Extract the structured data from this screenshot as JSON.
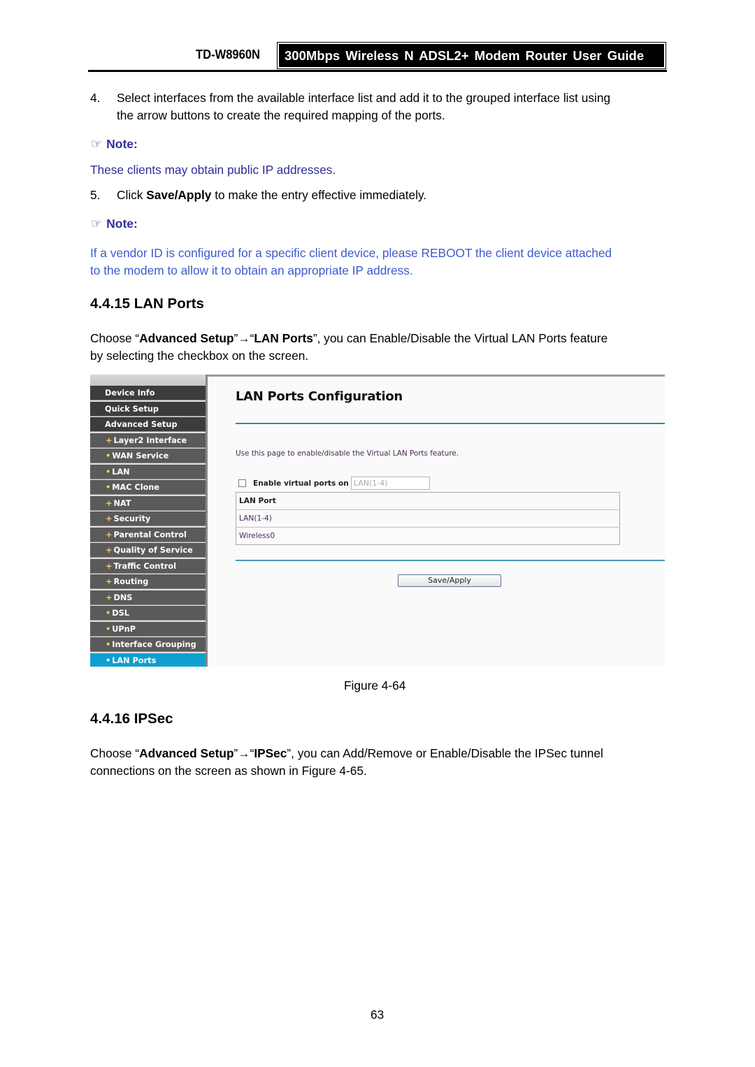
{
  "header": {
    "model": "TD-W8960N",
    "guide_title": "300Mbps Wireless N ADSL2+ Modem Router User Guide"
  },
  "steps": {
    "step4_number": "4.",
    "step4_line1": "Select interfaces from the available interface list and add it to the grouped interface list using",
    "step4_line2": "the arrow buttons to create the required mapping of the ports.",
    "step5_number": "5.",
    "step5_pre": "Click ",
    "step5_bold": "Save/Apply",
    "step5_post": " to make the entry effective immediately."
  },
  "notes": [
    {
      "icon": "pointing-hand-icon",
      "label": "Note:",
      "text": "These clients may obtain public IP addresses."
    },
    {
      "icon": "pointing-hand-icon",
      "label": "Note:",
      "line1": "If a vendor ID is configured for a specific client device, please REBOOT the client device attached",
      "line2": "to the modem to allow it to obtain an appropriate IP address."
    }
  ],
  "section_lan": {
    "heading": "4.4.15 LAN Ports",
    "p_pre": "Choose “",
    "p_bold1": "Advanced Setup",
    "p_mid": "”→“",
    "p_bold2": "LAN Ports",
    "p_post": "”, you can Enable/Disable the Virtual LAN Ports feature",
    "p_line2": "by selecting the checkbox on the screen."
  },
  "figure": {
    "sidebar": [
      {
        "label": "Device Info",
        "type": "top",
        "bullet": ""
      },
      {
        "label": "Quick Setup",
        "type": "top",
        "bullet": ""
      },
      {
        "label": "Advanced Setup",
        "type": "top",
        "bullet": ""
      },
      {
        "label": "Layer2 Interface",
        "type": "sub",
        "bullet": "+"
      },
      {
        "label": "WAN Service",
        "type": "sub",
        "bullet": "•"
      },
      {
        "label": "LAN",
        "type": "sub",
        "bullet": "•"
      },
      {
        "label": "MAC Clone",
        "type": "sub",
        "bullet": "•"
      },
      {
        "label": "NAT",
        "type": "sub",
        "bullet": "+"
      },
      {
        "label": "Security",
        "type": "sub",
        "bullet": "+"
      },
      {
        "label": "Parental Control",
        "type": "sub",
        "bullet": "+"
      },
      {
        "label": "Quality of Service",
        "type": "sub",
        "bullet": "+"
      },
      {
        "label": "Traffic Control",
        "type": "sub",
        "bullet": "+"
      },
      {
        "label": "Routing",
        "type": "sub",
        "bullet": "+"
      },
      {
        "label": "DNS",
        "type": "sub",
        "bullet": "+"
      },
      {
        "label": "DSL",
        "type": "sub",
        "bullet": "•"
      },
      {
        "label": "UPnP",
        "type": "sub",
        "bullet": "•"
      },
      {
        "label": "Interface Grouping",
        "type": "sub",
        "bullet": "•"
      },
      {
        "label": "LAN Ports",
        "type": "active",
        "bullet": "•"
      }
    ],
    "panel_title": "LAN Ports Configuration",
    "description": "Use this page to enable/disable the Virtual LAN Ports feature.",
    "checkbox_label": "Enable virtual ports on",
    "checkbox_checked": false,
    "ports_input_value": "LAN(1-4)",
    "table_header": "LAN Port",
    "table_rows": [
      "LAN(1-4)",
      "Wireless0"
    ],
    "save_button": "Save/Apply",
    "active_color": "#0f9fcf"
  },
  "figure_caption": "Figure 4-64",
  "section_ipsec": {
    "heading": "4.4.16 IPSec",
    "p_pre": "Choose “",
    "p_bold1": "Advanced Setup",
    "p_mid": "”→“",
    "p_bold2": "IPSec",
    "p_post": "”, you can Add/Remove or Enable/Disable the IPSec tunnel",
    "p_line2": "connections on the screen as shown in Figure 4-65."
  },
  "page_number": "63"
}
